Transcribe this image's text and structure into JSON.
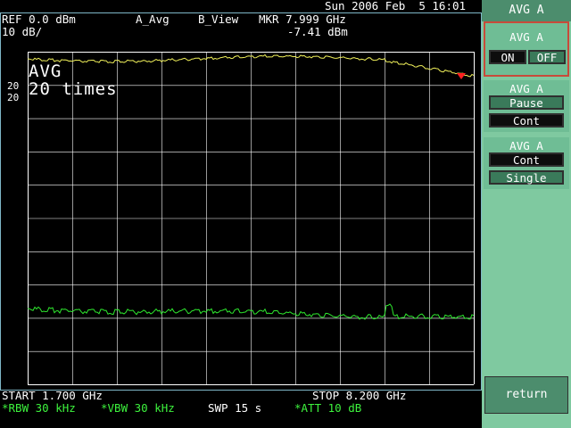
{
  "header": {
    "datetime": "Sun 2006 Feb  5 16:01",
    "ref_level": "REF 0.0 dBm",
    "scale": "10 dB/",
    "trace_a": "A_Avg",
    "trace_b": "B_View",
    "marker_freq": "MKR 7.999 GHz",
    "marker_level": "-7.41 dBm"
  },
  "overlay": {
    "avg_label": "AVG",
    "avg_count": "20 times",
    "counter_top": "20",
    "counter_bottom": "20"
  },
  "footer": {
    "start": "START 1.700 GHz",
    "stop": "STOP 8.200 GHz",
    "rbw": "*RBW 30 kHz",
    "vbw": "*VBW 30 kHz",
    "sweep": "SWP 15 s",
    "att": "*ATT 10 dB"
  },
  "softkeys": {
    "title": "AVG A",
    "group1": {
      "label": "AVG A",
      "on": "ON",
      "off": "OFF",
      "state": "ON"
    },
    "group2": {
      "label": "AVG A",
      "pause": "Pause",
      "cont": "Cont"
    },
    "group3": {
      "label": "AVG A",
      "cont": "Cont",
      "single": "Single"
    },
    "return": "return"
  },
  "colors": {
    "trace_yellow": "#f0f05a",
    "trace_green": "#2ee82e",
    "marker": "#ff2020",
    "grid": "#ffffff",
    "panel": "#7fc9a0",
    "panel_dark": "#4c8d6d"
  }
}
